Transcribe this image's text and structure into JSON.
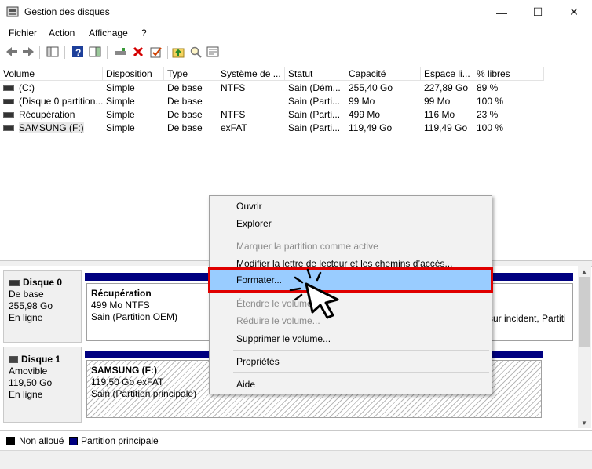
{
  "window": {
    "title": "Gestion des disques",
    "controls": {
      "minimize": "—",
      "maximize": "☐",
      "close": "✕"
    }
  },
  "menu": [
    "Fichier",
    "Action",
    "Affichage",
    "?"
  ],
  "toolbar_icons": [
    "back-arrow-icon",
    "forward-arrow-icon",
    "console-tree-icon",
    "help-icon",
    "action-pane-icon",
    "connect-drive-icon",
    "delete-icon",
    "checkmark-icon",
    "folder-up-icon",
    "search-icon",
    "properties-icon"
  ],
  "table": {
    "columns": [
      "Volume",
      "Disposition",
      "Type",
      "Système de ...",
      "Statut",
      "Capacité",
      "Espace li...",
      "% libres"
    ],
    "rows": [
      [
        "(C:)",
        "Simple",
        "De base",
        "NTFS",
        "Sain (Dém...",
        "255,40 Go",
        "227,89 Go",
        "89 %"
      ],
      [
        "(Disque 0 partition...",
        "Simple",
        "De base",
        "",
        "Sain (Parti...",
        "99 Mo",
        "99 Mo",
        "100 %"
      ],
      [
        "Récupération",
        "Simple",
        "De base",
        "NTFS",
        "Sain (Parti...",
        "499 Mo",
        "116 Mo",
        "23 %"
      ],
      [
        "SAMSUNG (F:)",
        "Simple",
        "De base",
        "exFAT",
        "Sain (Parti...",
        "119,49 Go",
        "119,49 Go",
        "100 %"
      ]
    ]
  },
  "disks": {
    "disk0": {
      "name": "Disque 0",
      "type": "De base",
      "size": "255,98 Go",
      "status": "En ligne",
      "partition": {
        "name": "Récupération",
        "size": "499 Mo NTFS",
        "status": "Sain (Partition OEM)"
      },
      "right_text": "sur incident, Partiti"
    },
    "disk1": {
      "name": "Disque 1",
      "type": "Amovible",
      "size": "119,50 Go",
      "status": "En ligne",
      "partition": {
        "name": "SAMSUNG  (F:)",
        "size": "119,50 Go exFAT",
        "status": "Sain (Partition principale)"
      }
    }
  },
  "legend": {
    "unallocated": "Non alloué",
    "primary": "Partition principale"
  },
  "context_menu": {
    "items": [
      {
        "label": "Ouvrir",
        "enabled": true
      },
      {
        "label": "Explorer",
        "enabled": true
      },
      {
        "label": "Marquer la partition comme active",
        "enabled": false
      },
      {
        "label": "Modifier la lettre de lecteur et les chemins d’accès...",
        "enabled": true
      },
      {
        "label": "Formater...",
        "enabled": true,
        "highlighted": true
      },
      {
        "label": "Étendre le volume...",
        "enabled": false
      },
      {
        "label": "Réduire le volume...",
        "enabled": false
      },
      {
        "label": "Supprimer le volume...",
        "enabled": true
      },
      {
        "label": "Propriétés",
        "enabled": true
      },
      {
        "label": "Aide",
        "enabled": true
      }
    ]
  },
  "colors": {
    "primary_partition": "#000080",
    "highlight": "#99ccff",
    "highlight_border": "#e00000"
  }
}
